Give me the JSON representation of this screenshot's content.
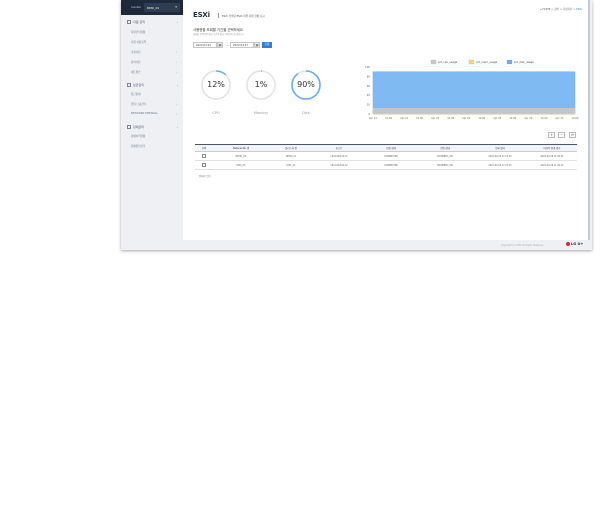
{
  "sidebar": {
    "center_label": "Center",
    "center_value": "DMC_01",
    "groups": [
      {
        "label": "자원 관리",
        "items": [
          {
            "label": "자원관리현황",
            "chev": false
          },
          {
            "label": "자원 이용요약",
            "chev": false
          },
          {
            "label": "가상자산",
            "chev": true
          },
          {
            "label": "장비자산",
            "chev": true
          },
          {
            "label": "네트워크",
            "chev": true
          }
        ]
      },
      {
        "label": "보안관리",
        "items": [
          {
            "label": "접근통제",
            "chev": false
          },
          {
            "label": "권한/그룹관리",
            "chev": true
          },
          {
            "label": "NETWORK FIREWALL",
            "chev": true
          }
        ]
      },
      {
        "label": "장애관리",
        "items": [
          {
            "label": "장애이력현황",
            "chev": false
          },
          {
            "label": "장애원인분석",
            "chev": false
          }
        ]
      }
    ]
  },
  "header": {
    "logo": "ESXi",
    "subtitle": "ESXi 선택된 ESXi 하위 자원 현황 표시",
    "breadcrumb": [
      "HOME",
      "장비",
      "가상자산",
      "ESXi"
    ]
  },
  "filter": {
    "title": "사용현황 조회할 기간을 선택하세요",
    "desc": "날짜를 선택하면 해당 기간의 평균 사용량이 표시됩니다",
    "start_date": "2022-04-21",
    "end_date": "2022-04-27",
    "tilde": "~",
    "search_label": "조회",
    "calendar_glyph": "▦"
  },
  "gauges": [
    {
      "label": "CPU",
      "value_text": "12%",
      "percent": 12
    },
    {
      "label": "Memory",
      "value_text": "1%",
      "percent": 1
    },
    {
      "label": "Disk",
      "value_text": "90%",
      "percent": 90
    }
  ],
  "chart_data": {
    "type": "area",
    "x_ticks": [
      "Apr 21",
      "12:00",
      "Apr 22",
      "12:00",
      "Apr 23",
      "12:00",
      "Apr 24",
      "12:00",
      "Apr 25",
      "12:00",
      "Apr 26",
      "12:00",
      "Apr 27",
      "12:00"
    ],
    "y_ticks": [
      0,
      20,
      40,
      60,
      80,
      100
    ],
    "ylim": [
      0,
      100
    ],
    "legend_position": "top-right",
    "series": [
      {
        "name": "pct_cpu_usage",
        "color": "#c9c9c9",
        "values": [
          12,
          12,
          12,
          12,
          12,
          12,
          12,
          12,
          12,
          12,
          12,
          12,
          12,
          12
        ]
      },
      {
        "name": "pct_mem_usage",
        "color": "#f6d77e",
        "values": [
          1,
          1,
          1,
          1,
          1,
          1,
          1,
          1,
          1,
          1,
          1,
          1,
          1,
          1
        ]
      },
      {
        "name": "pct_disk_usage",
        "color": "#6aaef0",
        "values": [
          90,
          90,
          90,
          90,
          90,
          90,
          90,
          90,
          90,
          90,
          90,
          90,
          90,
          90
        ]
      }
    ]
  },
  "table": {
    "controls": {
      "add": "+",
      "remove": "−",
      "refresh": "⟳"
    },
    "headers": [
      "선택",
      "Datacenter 명",
      "클러스터 명",
      "호스트",
      "연결 상태",
      "전원 상태",
      "등록 일자",
      "마지막 변경 일자"
    ],
    "rows": [
      [
        "",
        "DEMO_DC",
        "DEMO_CL",
        "192.168.100.11",
        "CONNECTED",
        "POWERED_ON",
        "2022-02-28 17:21:45",
        "2022-04-28 11:00:01"
      ],
      [
        "",
        "DMC_DC",
        "DMC_CL",
        "192.168.100.12",
        "CONNECTED",
        "POWERED_ON",
        "2022-02-28 17:21:45",
        "2022-04-28 11:00:01"
      ]
    ],
    "total": "전체 2 건수"
  },
  "footer": {
    "copyright": "Copyright (C) DMC All Rights Reserved.",
    "brand": "LG U+",
    "brand_color": "#d22b2b"
  }
}
